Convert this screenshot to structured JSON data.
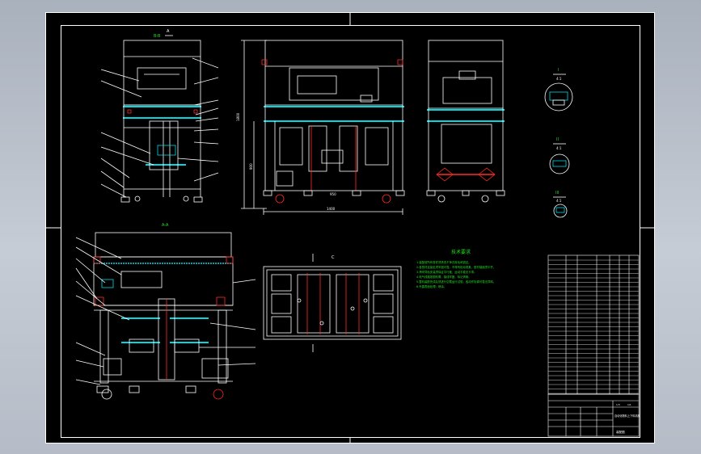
{
  "drawing": {
    "view_labels": {
      "front_left": "B-B",
      "side_bottom": "A-A"
    },
    "section_marks": {
      "top_letter": "A",
      "mid_letter": "C",
      "detail_I": "I",
      "detail_II": "II",
      "detail_III": "III",
      "scale_I": "4:1",
      "scale_II": "4:1",
      "scale_III": "4:1"
    },
    "tech_title": "技术要求",
    "tech_notes": [
      "1.装配前所有零件须清洗干净去除毛刺锐边。",
      "2.各型材连接处须牢固可靠，不得有松动现象，型材端面须平齐。",
      "3.滑块导轨安装须保证平行度，运动平稳无卡滞。",
      "4.电气线路按图布置，接线牢固，标记清晰。",
      "5.整机装配完成后须进行空载运行试验，各动作协调可靠无异响。",
      "6.外露表面处理：喷涂。"
    ],
    "dimensions": {
      "front_width": "1400",
      "front_inner": "950",
      "height_total": "1800",
      "height_inner": "900"
    },
    "title_block": {
      "name": "自动化物料上下料机构",
      "drawing_no": "装配图",
      "scale": "1:5",
      "sheet": "1/1"
    },
    "colors": {
      "frame": "#ffffff",
      "cyan": "#00d7e0",
      "red": "#ff2a2a",
      "green": "#21e021",
      "bg": "#000000"
    }
  }
}
